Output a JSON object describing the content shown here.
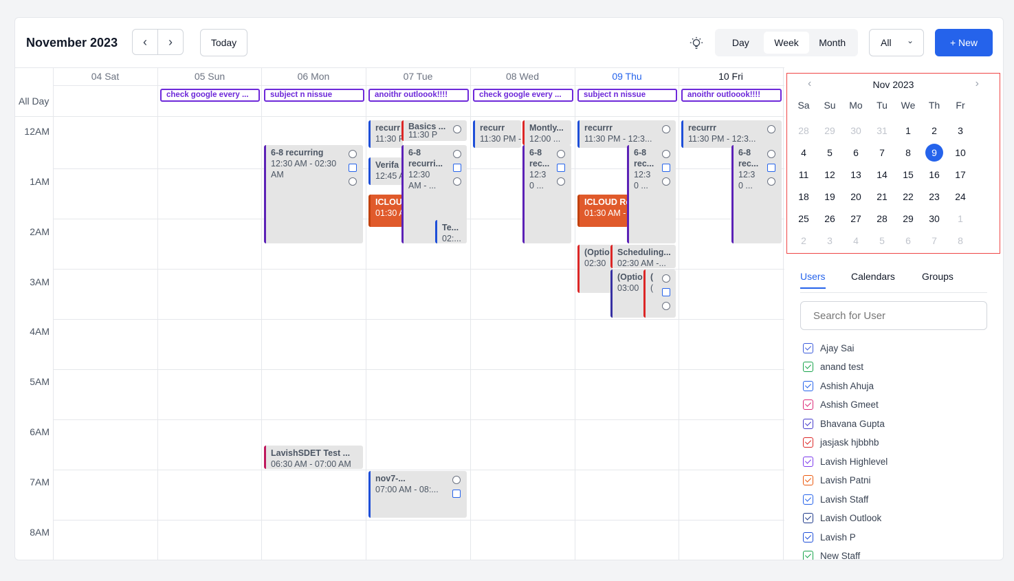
{
  "header": {
    "title": "November 2023",
    "today_label": "Today",
    "views": [
      "Day",
      "Week",
      "Month"
    ],
    "active_view": "Week",
    "filter_value": "All",
    "new_label": "+ New"
  },
  "grid": {
    "all_day_label": "All Day",
    "days": [
      "04 Sat",
      "05 Sun",
      "06 Mon",
      "07 Tue",
      "08 Wed",
      "09 Thu",
      "10 Fri"
    ],
    "hours": [
      "12AM",
      "1AM",
      "2AM",
      "3AM",
      "4AM",
      "5AM",
      "6AM",
      "7AM",
      "8AM"
    ],
    "all_day_events": [
      "check google every ...",
      "subject n nissue",
      "anoithr outloook!!!!",
      "check google every ...",
      "subject n nissue",
      "anoithr outloook!!!!"
    ],
    "events": {
      "mon1": {
        "title": "6-8 recurring",
        "time": "12:30 AM - 02:30",
        "time2": "AM"
      },
      "mon2": {
        "title": "LavishSDET Test ...",
        "time": "06:30 AM - 07:00 AM"
      },
      "tue1": {
        "title": "recurr",
        "time": "11:30 F"
      },
      "tue2": {
        "title": "Basics ...",
        "time": "11:30 P"
      },
      "tue3": {
        "title": "6-8",
        "title2": "recurri...",
        "time": "12:30",
        "time2": "AM - ..."
      },
      "tue4": {
        "title": "Verifa",
        "time": "12:45 A"
      },
      "tue5": {
        "title": "ICLOUI",
        "time": "01:30 A"
      },
      "tue6": {
        "title": "Te...",
        "time": "02:..."
      },
      "tue7": {
        "title": "nov7-...",
        "time": "07:00 AM - 08:..."
      },
      "wed1": {
        "title": "recurr",
        "time": "11:30 PM -"
      },
      "wed2": {
        "title": "Montly...",
        "time": "12:00 ..."
      },
      "wed3": {
        "title": "6-8",
        "title2": "rec...",
        "time": "12:3",
        "time2": "0 ..."
      },
      "thu1": {
        "title": "recurrr",
        "time": "11:30 PM - 12:3..."
      },
      "thu2": {
        "title": "6-8",
        "title2": "rec...",
        "time": "12:3",
        "time2": "0 ..."
      },
      "thu3": {
        "title": "ICLOUD Re",
        "time": "01:30 AM -"
      },
      "thu4": {
        "title": "(Optio",
        "time": "02:30"
      },
      "thu5": {
        "title": "Scheduling...",
        "time": "02:30 AM -..."
      },
      "thu6": {
        "title": "(Optio",
        "time": "03:00"
      },
      "thu7": {
        "title": "(",
        "time": "("
      },
      "fri1": {
        "title": "recurrr",
        "time": "11:30 PM - 12:3..."
      },
      "fri2": {
        "title": "6-8",
        "title2": "rec...",
        "time": "12:3",
        "time2": "0 ..."
      }
    }
  },
  "mini_calendar": {
    "title": "Nov 2023",
    "weekdays": [
      "Sa",
      "Su",
      "Mo",
      "Tu",
      "We",
      "Th",
      "Fr"
    ],
    "days": [
      "28",
      "29",
      "30",
      "31",
      "1",
      "2",
      "3",
      "4",
      "5",
      "6",
      "7",
      "8",
      "9",
      "10",
      "11",
      "12",
      "13",
      "14",
      "15",
      "16",
      "17",
      "18",
      "19",
      "20",
      "21",
      "22",
      "23",
      "24",
      "25",
      "26",
      "27",
      "28",
      "29",
      "30",
      "1",
      "2",
      "3",
      "4",
      "5",
      "6",
      "7",
      "8"
    ],
    "selected": "9"
  },
  "sidebar": {
    "tabs": [
      "Users",
      "Calendars",
      "Groups"
    ],
    "search_placeholder": "Search for User",
    "users": [
      {
        "name": "Ajay Sai",
        "color": "#3b5bdb"
      },
      {
        "name": "anand test",
        "color": "#16a34a"
      },
      {
        "name": "Ashish Ahuja",
        "color": "#2563eb"
      },
      {
        "name": "Ashish Gmeet",
        "color": "#db2777"
      },
      {
        "name": "Bhavana Gupta",
        "color": "#4338ca"
      },
      {
        "name": "jasjask hjbbhb",
        "color": "#dc2626"
      },
      {
        "name": "Lavish Highlevel",
        "color": "#7c3aed"
      },
      {
        "name": "Lavish Patni",
        "color": "#ea580c"
      },
      {
        "name": "Lavish Staff",
        "color": "#2563eb"
      },
      {
        "name": "Lavish Outlook",
        "color": "#1e3a8a"
      },
      {
        "name": "Lavish P",
        "color": "#1d4ed8"
      },
      {
        "name": "New Staff",
        "color": "#16a34a"
      }
    ]
  }
}
